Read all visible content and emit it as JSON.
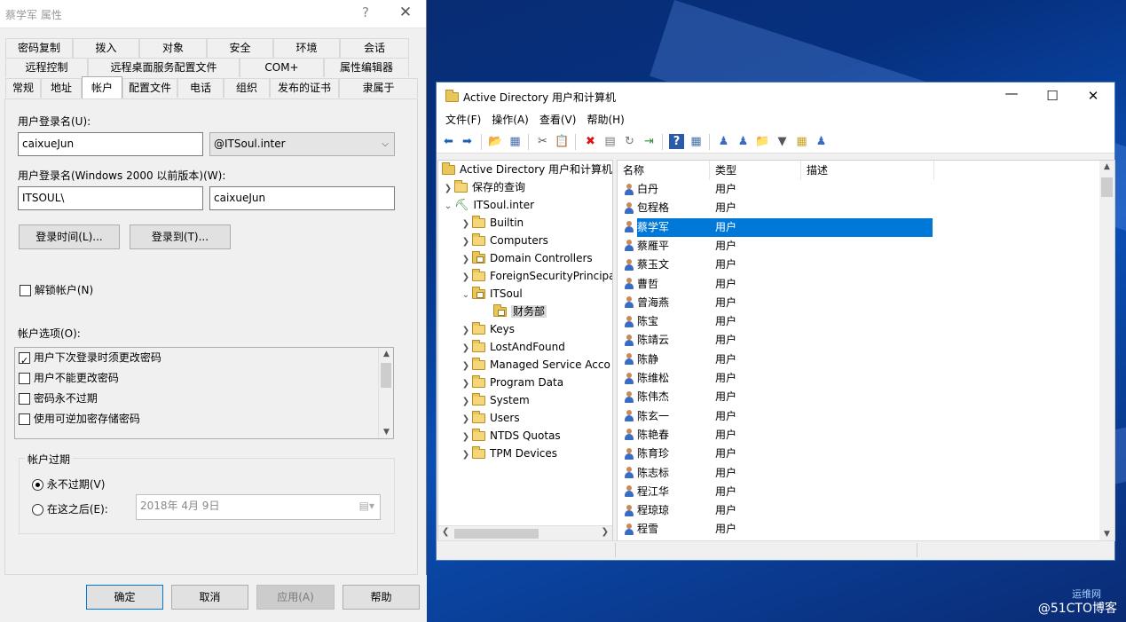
{
  "props_dialog": {
    "title": "蔡学军 属性",
    "help_label": "?",
    "close_label": "✕",
    "tabs_row1": [
      "密码复制",
      "拨入",
      "对象",
      "安全",
      "环境",
      "会话"
    ],
    "tabs_row2": [
      "远程控制",
      "远程桌面服务配置文件",
      "COM+",
      "属性编辑器"
    ],
    "tabs_row3": [
      "常规",
      "地址",
      "帐户",
      "配置文件",
      "电话",
      "组织",
      "发布的证书",
      "隶属于"
    ],
    "active_tab": "帐户",
    "logon_name_label": "用户登录名(U):",
    "logon_name_value": "caixueJun",
    "domain_suffix": "@ITSoul.inter",
    "pre2000_label": "用户登录名(Windows 2000 以前版本)(W):",
    "pre2000_domain": "ITSOUL\\",
    "pre2000_name": "caixueJun",
    "logon_hours_button": "登录时间(L)...",
    "logon_to_button": "登录到(T)...",
    "unlock_label": "解锁帐户(N)",
    "account_options_label": "帐户选项(O):",
    "account_options": [
      {
        "label": "用户下次登录时须更改密码",
        "checked": true
      },
      {
        "label": "用户不能更改密码",
        "checked": false
      },
      {
        "label": "密码永不过期",
        "checked": false
      },
      {
        "label": "使用可逆加密存储密码",
        "checked": false
      }
    ],
    "expiry_group_label": "帐户过期",
    "never_expires_label": "永不过期(V)",
    "end_of_label": "在这之后(E):",
    "expiry_date": "2018年  4月  9日",
    "ok_button": "确定",
    "cancel_button": "取消",
    "apply_button": "应用(A)",
    "help_button": "帮助"
  },
  "ad_window": {
    "title": "Active Directory 用户和计算机",
    "menu": [
      "文件(F)",
      "操作(A)",
      "查看(V)",
      "帮助(H)"
    ],
    "tree": {
      "root": "Active Directory 用户和计算机",
      "saved_queries": "保存的查询",
      "domain": "ITSoul.inter",
      "children": [
        "Builtin",
        "Computers",
        "Domain Controllers",
        "ForeignSecurityPrincipa",
        "ITSoul",
        "Keys",
        "LostAndFound",
        "Managed Service Acco",
        "Program Data",
        "System",
        "Users",
        "NTDS Quotas",
        "TPM Devices"
      ],
      "selected_ou": "财务部"
    },
    "columns": [
      "名称",
      "类型",
      "描述"
    ],
    "rows": [
      {
        "name": "白丹",
        "type": "用户"
      },
      {
        "name": "包程格",
        "type": "用户"
      },
      {
        "name": "蔡学军",
        "type": "用户"
      },
      {
        "name": "蔡雁平",
        "type": "用户"
      },
      {
        "name": "蔡玉文",
        "type": "用户"
      },
      {
        "name": "曹哲",
        "type": "用户"
      },
      {
        "name": "曾海燕",
        "type": "用户"
      },
      {
        "name": "陈宝",
        "type": "用户"
      },
      {
        "name": "陈靖云",
        "type": "用户"
      },
      {
        "name": "陈静",
        "type": "用户"
      },
      {
        "name": "陈维松",
        "type": "用户"
      },
      {
        "name": "陈伟杰",
        "type": "用户"
      },
      {
        "name": "陈玄一",
        "type": "用户"
      },
      {
        "name": "陈艳春",
        "type": "用户"
      },
      {
        "name": "陈育珍",
        "type": "用户"
      },
      {
        "name": "陈志标",
        "type": "用户"
      },
      {
        "name": "程江华",
        "type": "用户"
      },
      {
        "name": "程琼琼",
        "type": "用户"
      },
      {
        "name": "程雪",
        "type": "用户"
      }
    ],
    "selected_row": "蔡学军"
  },
  "watermark": {
    "main": "@51CTO博客",
    "small": "运维网"
  },
  "colors": {
    "selection": "#0078d7",
    "desktop": "#0a3a8f"
  }
}
